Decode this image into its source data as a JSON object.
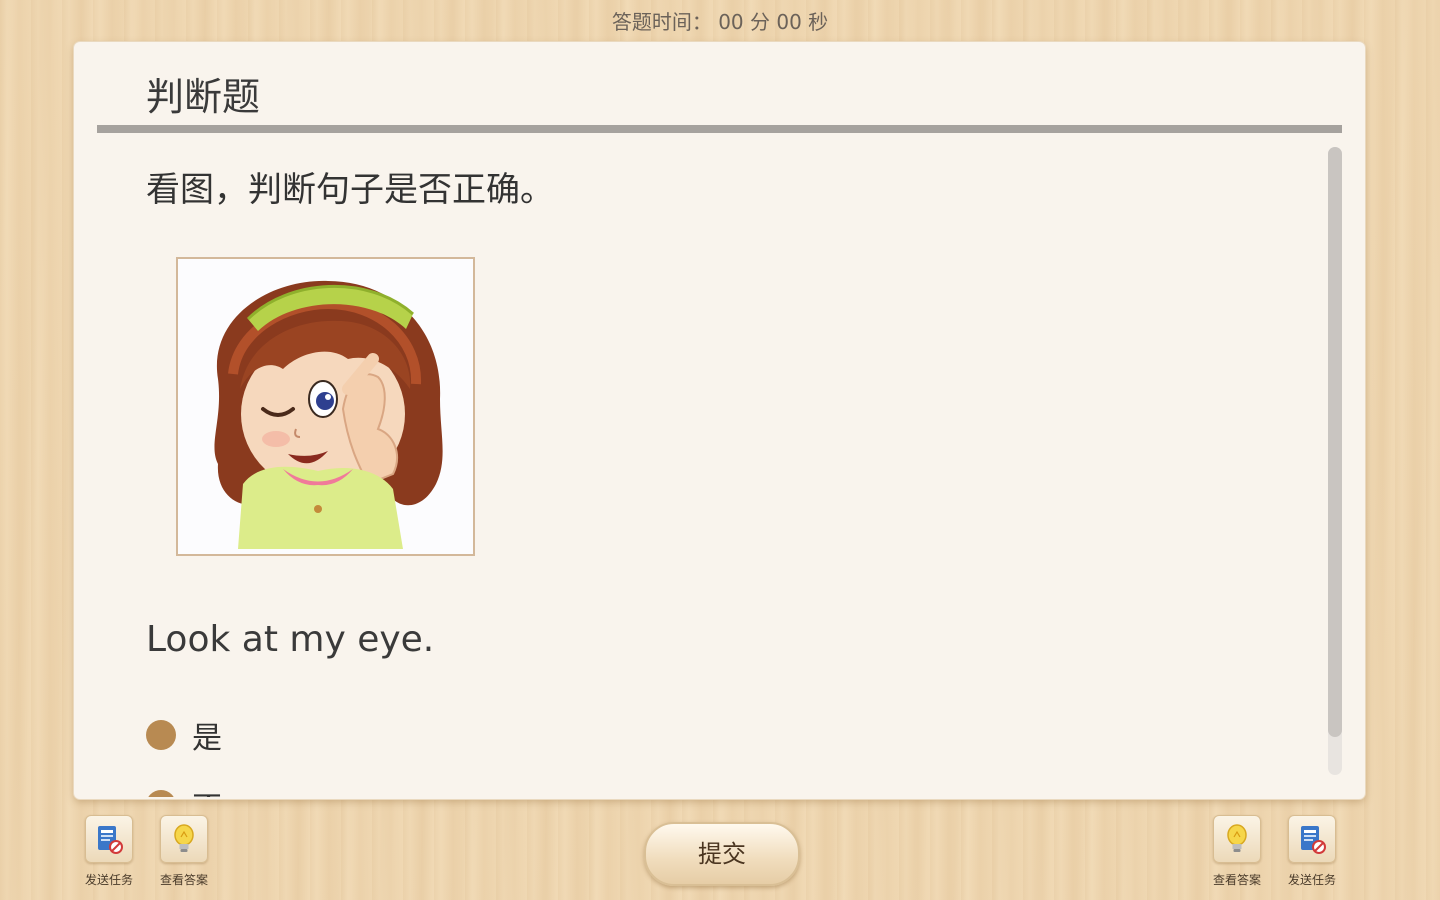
{
  "timer": {
    "label": "答题时间：",
    "minutes": "00",
    "minutes_unit": "分",
    "seconds": "00",
    "seconds_unit": "秒"
  },
  "question": {
    "type_title": "判断题",
    "instruction": "看图，判断句子是否正确。",
    "sentence": "Look at my eye.",
    "options": [
      {
        "label": "是"
      },
      {
        "label": "否"
      }
    ]
  },
  "toolbar": {
    "left": [
      {
        "label": "发送任务",
        "icon": "send-task-icon"
      },
      {
        "label": "查看答案",
        "icon": "lightbulb-icon"
      }
    ],
    "right": [
      {
        "label": "查看答案",
        "icon": "lightbulb-icon"
      },
      {
        "label": "发送任务",
        "icon": "send-task-icon"
      }
    ],
    "submit_label": "提交"
  },
  "colors": {
    "accent_brown": "#b88a52",
    "card_background": "#f9f4ed",
    "wood_background": "#efd7b1"
  }
}
